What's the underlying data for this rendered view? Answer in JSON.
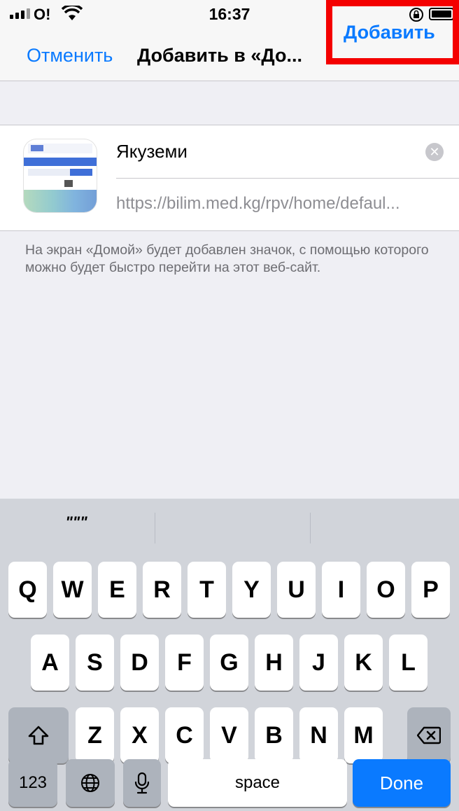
{
  "status_bar": {
    "carrier": "O!",
    "time": "16:37",
    "icons": [
      "signal-icon",
      "wifi-icon",
      "orientation-lock-icon",
      "battery-icon"
    ]
  },
  "nav": {
    "cancel_label": "Отменить",
    "title": "Добавить в «До...",
    "add_label": "Добавить",
    "highlight_color": "#f40000"
  },
  "form": {
    "name_value": "Якуземи",
    "url_value": "https://bilim.med.kg/rpv/home/defaul...",
    "clear_icon": "clear-icon"
  },
  "hint_text": "На экран «Домой» будет добавлен значок, с помощью которого можно будет быстро перейти на этот веб-сайт.",
  "keyboard": {
    "predictive": [
      "\"\"\"",
      "",
      ""
    ],
    "row1": [
      "Q",
      "W",
      "E",
      "R",
      "T",
      "Y",
      "U",
      "I",
      "O",
      "P"
    ],
    "row2": [
      "A",
      "S",
      "D",
      "F",
      "G",
      "H",
      "J",
      "K",
      "L"
    ],
    "row3": [
      "Z",
      "X",
      "C",
      "V",
      "B",
      "N",
      "M"
    ],
    "numbers_label": "123",
    "space_label": "space",
    "done_label": "Done",
    "accent_color": "#0a7aff"
  }
}
